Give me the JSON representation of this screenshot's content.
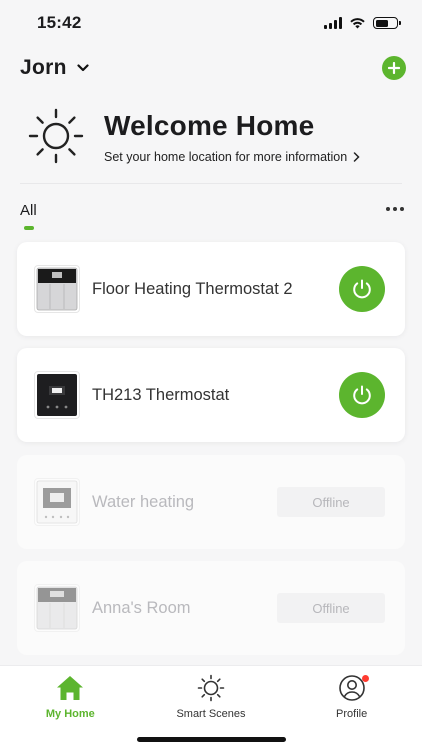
{
  "status_bar": {
    "time": "15:42"
  },
  "header": {
    "home_name": "Jorn"
  },
  "welcome": {
    "title": "Welcome Home",
    "subtitle": "Set your home location for more information"
  },
  "tabs": {
    "active_label": "All"
  },
  "devices": [
    {
      "name": "Floor Heating Thermostat 2",
      "status": "online",
      "power": true
    },
    {
      "name": "TH213 Thermostat",
      "status": "online",
      "power": true
    },
    {
      "name": "Water heating",
      "status": "offline",
      "badge": "Offline"
    },
    {
      "name": "Anna's Room",
      "status": "offline",
      "badge": "Offline"
    }
  ],
  "bottom_nav": [
    {
      "label": "My Home",
      "active": true
    },
    {
      "label": "Smart Scenes",
      "active": false
    },
    {
      "label": "Profile",
      "active": false
    }
  ],
  "colors": {
    "accent": "#5cb52e",
    "notification": "#ff3b30"
  }
}
